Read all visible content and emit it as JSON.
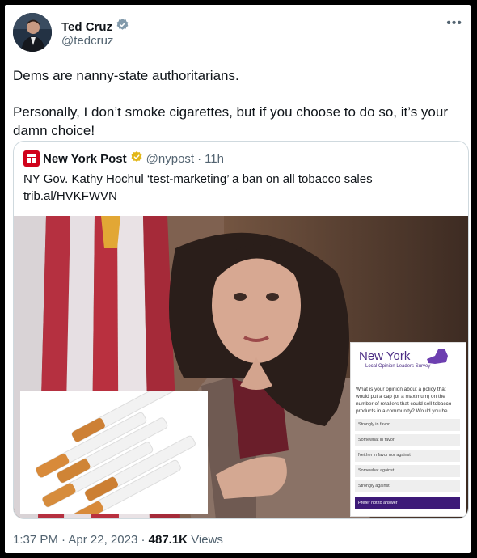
{
  "author": {
    "name": "Ted Cruz",
    "handle": "@tedcruz",
    "verified_color": "#829aab"
  },
  "tweet": {
    "paragraphs": [
      "Dems are nanny-state authoritarians.",
      "Personally, I don’t smoke cigarettes, but if you choose to do so, it’s your damn choice!"
    ]
  },
  "quoted": {
    "name": "New York Post",
    "handle": "@nypost",
    "separator": "·",
    "time": "11h",
    "text": "NY Gov. Kathy Hochul ‘test-marketing’ a ban on all tobacco sales",
    "link": "trib.al/HVKFWVN",
    "verified_color": "#e2b719"
  },
  "survey": {
    "title": "New York",
    "subtitle": "Local Opinion Leaders Survey",
    "question": "What is your opinion about a policy that would put a cap (or a maximum) on the number of retailers that could sell tobacco products in a community? Would you be...",
    "options": [
      "Strongly in favor",
      "Somewhat in favor",
      "Neither in favor nor against",
      "Somewhat against",
      "Strongly against",
      "Prefer not to answer"
    ],
    "selected_index": 5
  },
  "footer": {
    "time": "1:37 PM",
    "date": "Apr 22, 2023",
    "separator": "·",
    "views_count": "487.1K",
    "views_label": "Views"
  }
}
